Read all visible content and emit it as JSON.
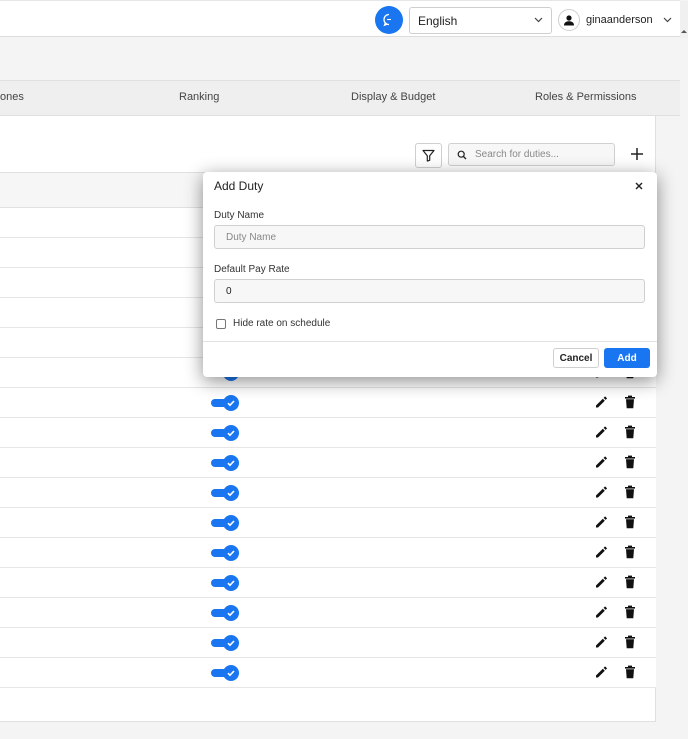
{
  "header": {
    "language": "English",
    "username": "ginaanderson",
    "chat_icon": "chat-bubble-icon",
    "avatar_icon": "person-icon"
  },
  "tabs": [
    {
      "label": "ones"
    },
    {
      "label": "Ranking"
    },
    {
      "label": "Display & Budget"
    },
    {
      "label": "Roles & Permissions"
    }
  ],
  "toolbar": {
    "search_placeholder": "Search for duties..."
  },
  "rows_count": 16,
  "modal": {
    "title": "Add Duty",
    "duty_name_label": "Duty Name",
    "duty_name_placeholder": "Duty Name",
    "pay_rate_label": "Default Pay Rate",
    "pay_rate_value": "0",
    "hide_rate_label": "Hide rate on schedule",
    "cancel_label": "Cancel",
    "add_label": "Add"
  },
  "colors": {
    "accent": "#1976f0"
  }
}
